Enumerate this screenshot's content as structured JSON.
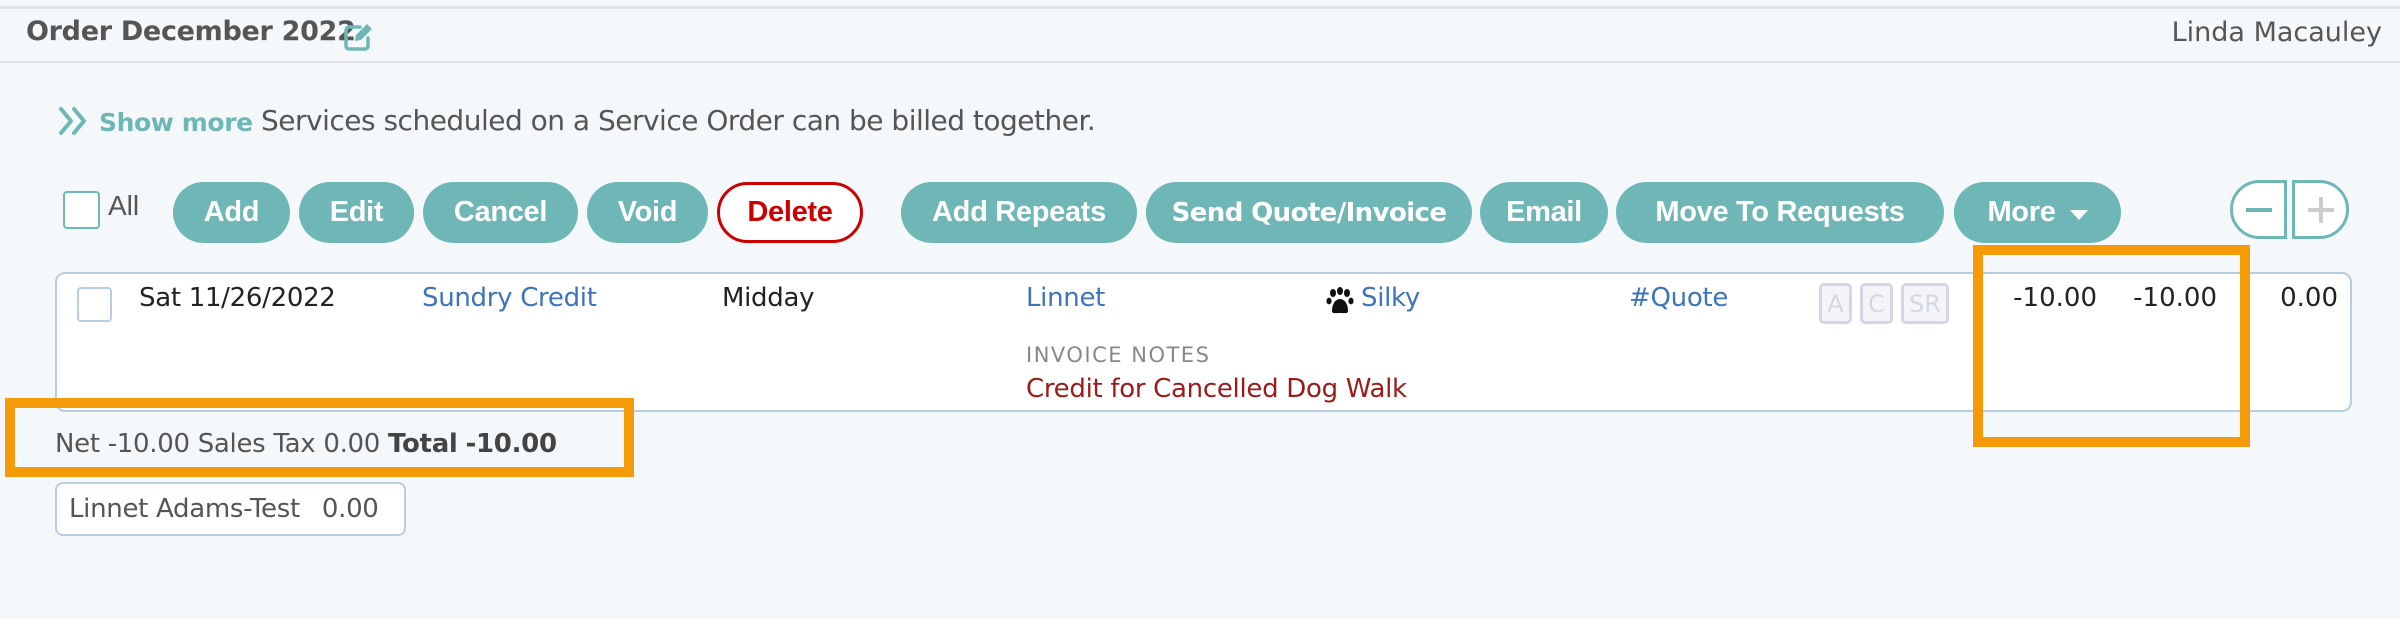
{
  "header": {
    "title": "Order December 2022",
    "user_name": "Linda Macauley"
  },
  "info": {
    "show_more_label": "Show more",
    "hint_text": "Services scheduled on a Service Order can be billed together."
  },
  "toolbar": {
    "select_all_label": "All",
    "buttons": {
      "add": "Add",
      "edit": "Edit",
      "cancel": "Cancel",
      "void": "Void",
      "delete": "Delete",
      "add_repeats": "Add Repeats",
      "send_quote_invoice": "Send Quote/Invoice",
      "email": "Email",
      "move_to_requests": "Move To Requests",
      "more": "More"
    }
  },
  "order_items": [
    {
      "date": "Sat 11/26/2022",
      "service": "Sundry Credit",
      "time_slot": "Midday",
      "client": "Linnet",
      "pet": "Silky",
      "status": "#Quote",
      "tags": [
        "A",
        "C",
        "SR"
      ],
      "amount_1": "-10.00",
      "amount_2": "-10.00",
      "amount_3": "0.00",
      "invoice_notes_label": "INVOICE NOTES",
      "invoice_notes": "Credit for Cancelled Dog Walk"
    }
  ],
  "totals": {
    "net_label": "Net",
    "net": "-10.00",
    "sales_tax_label": "Sales Tax",
    "sales_tax": "0.00",
    "total_label": "Total",
    "total": "-10.00"
  },
  "client_balance": {
    "name": "Linnet Adams-Test",
    "amount": "0.00"
  },
  "colors": {
    "accent": "#6fb7b6",
    "delete": "#cc0000",
    "link": "#3f74bd",
    "notes": "#9b1b1b",
    "highlight": "#f59b0a"
  }
}
